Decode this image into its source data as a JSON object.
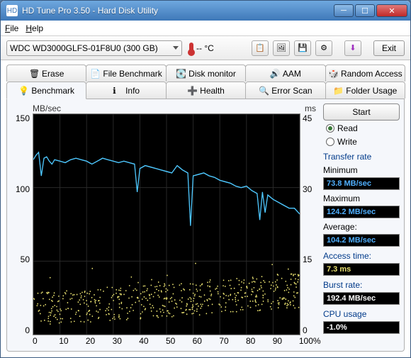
{
  "window": {
    "title": "HD Tune Pro 3.50 - Hard Disk Utility"
  },
  "menu": {
    "file": "File",
    "help": "Help"
  },
  "toolbar": {
    "drive": "WDC WD3000GLFS-01F8U0 (300 GB)",
    "temp": "--  °C",
    "exit": "Exit",
    "buttons": [
      "copy-icon",
      "screenshot-icon",
      "save-icon",
      "options-icon",
      "refresh-icon"
    ]
  },
  "tabs_top": [
    {
      "id": "erase",
      "label": "Erase"
    },
    {
      "id": "file-benchmark",
      "label": "File Benchmark"
    },
    {
      "id": "disk-monitor",
      "label": "Disk monitor"
    },
    {
      "id": "aam",
      "label": "AAM"
    },
    {
      "id": "random-access",
      "label": "Random Access"
    }
  ],
  "tabs_bottom": [
    {
      "id": "benchmark",
      "label": "Benchmark",
      "active": true
    },
    {
      "id": "info",
      "label": "Info"
    },
    {
      "id": "health",
      "label": "Health"
    },
    {
      "id": "error-scan",
      "label": "Error Scan"
    },
    {
      "id": "folder-usage",
      "label": "Folder Usage"
    }
  ],
  "side": {
    "start": "Start",
    "read": "Read",
    "write": "Write",
    "mode": "read",
    "transfer_label": "Transfer rate",
    "min_label": "Minimum",
    "min": "73.8 MB/sec",
    "max_label": "Maximum",
    "max": "124.2 MB/sec",
    "avg_label": "Average:",
    "avg": "104.2 MB/sec",
    "atime_label": "Access time:",
    "atime": "7.3 ms",
    "burst_label": "Burst rate:",
    "burst": "192.4 MB/sec",
    "cpu_label": "CPU usage",
    "cpu": "-1.0%"
  },
  "chart_data": {
    "type": "line",
    "title": "",
    "xlabel": "",
    "ylabel_left": "MB/sec",
    "ylabel_right": "ms",
    "xlim": [
      0,
      100
    ],
    "ylim_left": [
      0,
      150
    ],
    "ylim_right": [
      0,
      45
    ],
    "x_ticks": [
      0,
      10,
      20,
      30,
      40,
      50,
      60,
      70,
      80,
      90,
      100
    ],
    "y_left_ticks": [
      0,
      50,
      100,
      150
    ],
    "y_right_ticks": [
      0,
      15,
      30,
      45
    ],
    "series": [
      {
        "name": "Transfer rate",
        "axis": "left",
        "color": "#4ec8ff",
        "style": "line",
        "x": [
          0,
          1,
          2,
          3,
          4,
          5,
          6,
          7,
          8,
          10,
          12,
          14,
          16,
          18,
          20,
          22,
          24,
          26,
          28,
          30,
          32,
          34,
          36,
          38,
          39,
          40,
          42,
          44,
          46,
          48,
          50,
          52,
          54,
          56,
          58,
          59,
          60,
          62,
          64,
          66,
          68,
          70,
          72,
          74,
          76,
          78,
          80,
          82,
          84,
          85,
          86,
          87,
          88,
          90,
          92,
          94,
          96,
          98,
          100
        ],
        "values": [
          119,
          122,
          124,
          108,
          120,
          121,
          118,
          116,
          119,
          118,
          117,
          119,
          120,
          119,
          118,
          116,
          118,
          120,
          119,
          118,
          117,
          118,
          117,
          116,
          97,
          113,
          115,
          114,
          113,
          112,
          111,
          110,
          115,
          112,
          110,
          74,
          108,
          109,
          110,
          108,
          107,
          105,
          104,
          103,
          101,
          100,
          101,
          98,
          96,
          78,
          97,
          83,
          95,
          92,
          90,
          88,
          86,
          86,
          82
        ]
      },
      {
        "name": "Access time",
        "axis": "right",
        "color": "#e8e070",
        "style": "scatter",
        "note": "dense scatter cloud; y values in ms roughly between 3 and 13 ms across full x range, centroid ~7.3 ms, spread slightly increasing with x",
        "approx_range": [
          3,
          13
        ],
        "mean": 7.3
      }
    ]
  }
}
